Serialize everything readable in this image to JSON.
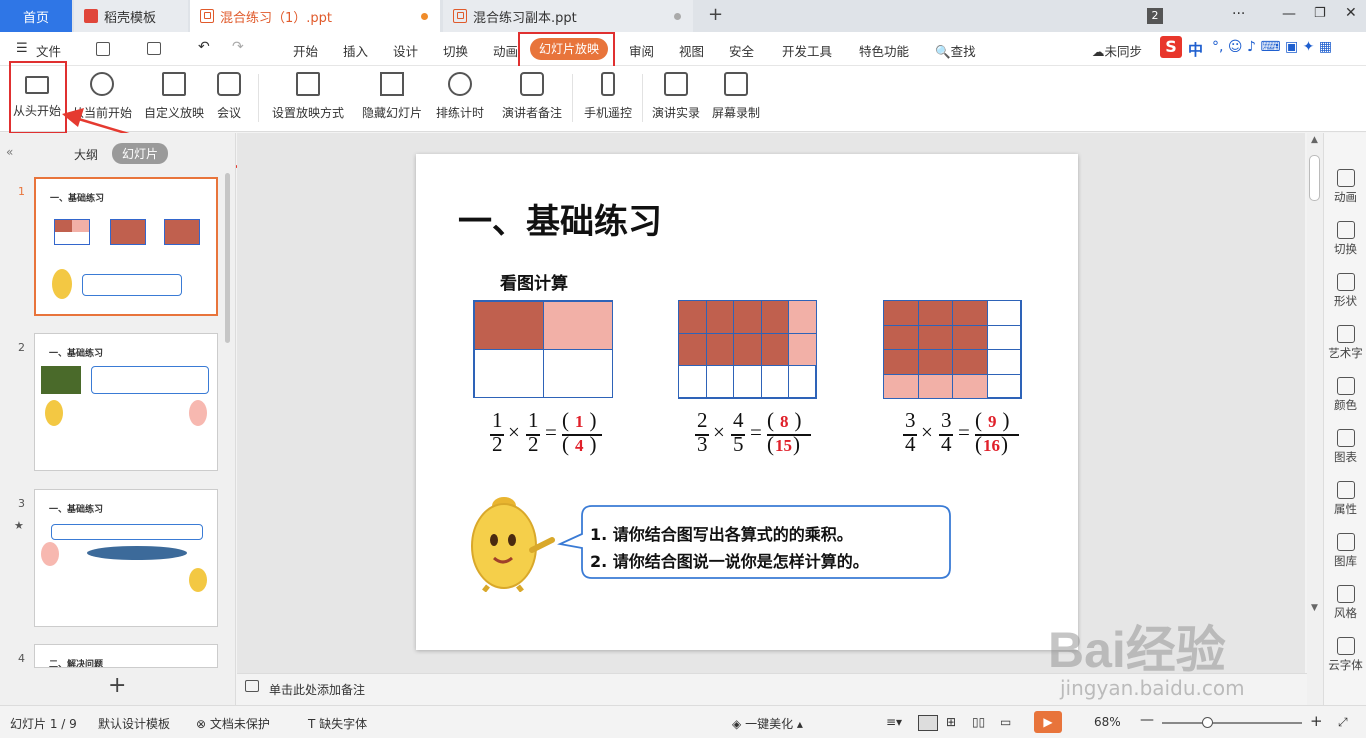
{
  "tabs": {
    "home": "首页",
    "template": "稻壳模板",
    "doc1": "混合练习（1）.ppt",
    "doc2": "混合练习副本.ppt",
    "badge": "2"
  },
  "menu": {
    "file": "文件",
    "items": [
      "开始",
      "插入",
      "设计",
      "切换",
      "动画",
      "幻灯片放映",
      "审阅",
      "视图",
      "安全",
      "开发工具",
      "特色功能"
    ],
    "active": "幻灯片放映",
    "search": "查找",
    "sync": "未同步",
    "ime": "中"
  },
  "ribbon": {
    "items": [
      "从头开始",
      "从当前开始",
      "自定义放映",
      "会议",
      "设置放映方式",
      "隐藏幻灯片",
      "排练计时",
      "演讲者备注",
      "手机遥控",
      "演讲实录",
      "屏幕录制"
    ]
  },
  "panel": {
    "outline": "大纲",
    "slides": "幻灯片"
  },
  "thumbs": [
    {
      "num": "1",
      "title": "一、基础练习"
    },
    {
      "num": "2",
      "title": "一、基础练习"
    },
    {
      "num": "3",
      "title": "一、基础练习"
    },
    {
      "num": "4",
      "title": "二、解决问题"
    }
  ],
  "slide": {
    "title": "一、基础练习",
    "subtitle": "看图计算",
    "eq1": {
      "a": "1",
      "b": "2",
      "c": "1",
      "d": "2",
      "ans_n": "1",
      "ans_d": "4"
    },
    "eq2": {
      "a": "2",
      "b": "3",
      "c": "4",
      "d": "5",
      "ans_n": "8",
      "ans_d": "15"
    },
    "eq3": {
      "a": "3",
      "b": "4",
      "c": "3",
      "d": "4",
      "ans_n": "9",
      "ans_d": "16"
    },
    "bubble": [
      "1. 请你结合图写出各算式的的乘积。",
      "2. 请你结合图说一说你是怎样计算的。"
    ]
  },
  "notes": "单击此处添加备注",
  "right": [
    "动画",
    "切换",
    "形状",
    "艺术字",
    "颜色",
    "图表",
    "属性",
    "图库",
    "风格",
    "云字体"
  ],
  "status": {
    "slide": "幻灯片 1 / 9",
    "template": "默认设计模板",
    "protect": "文档未保护",
    "font": "缺失字体",
    "beautify": "一键美化",
    "zoom": "68%"
  },
  "watermark": {
    "brand": "Bai经验",
    "url": "jingyan.baidu.com"
  }
}
